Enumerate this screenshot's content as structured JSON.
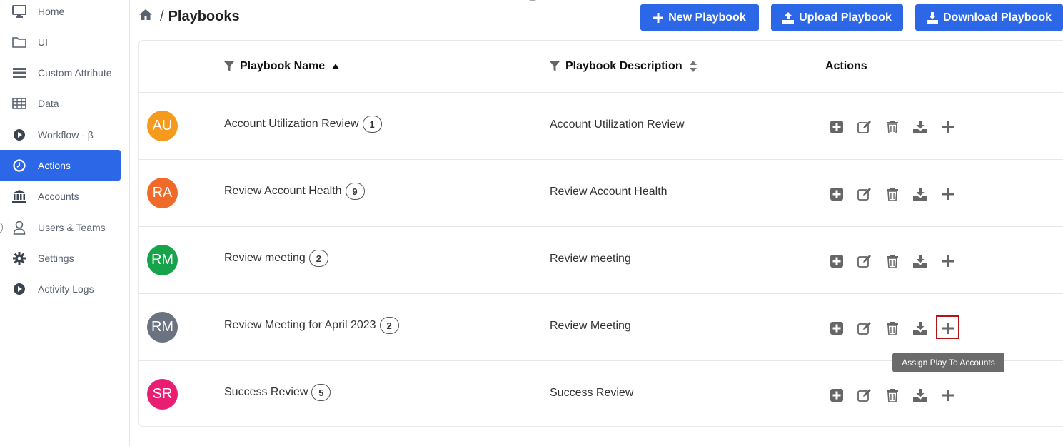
{
  "sidebar": {
    "items": [
      {
        "label": "Home",
        "icon": "monitor-icon"
      },
      {
        "label": "UI",
        "icon": "folder-icon"
      },
      {
        "label": "Custom Attribute",
        "icon": "list-icon"
      },
      {
        "label": "Data",
        "icon": "table-icon"
      },
      {
        "label": "Workflow - β",
        "icon": "play-icon"
      },
      {
        "label": "Actions",
        "icon": "clock-icon",
        "active": true
      },
      {
        "label": "Accounts",
        "icon": "bank-icon"
      },
      {
        "label": "Users & Teams",
        "icon": "user-icon"
      },
      {
        "label": "Settings",
        "icon": "gear-icon"
      },
      {
        "label": "Activity Logs",
        "icon": "play-icon"
      }
    ]
  },
  "header": {
    "breadcrumb_sep": "/",
    "title": "Playbooks",
    "new_label": "New Playbook",
    "upload_label": "Upload Playbook",
    "download_label": "Download Playbook"
  },
  "table": {
    "col_name": "Playbook Name",
    "col_desc": "Playbook Description",
    "col_actions": "Actions",
    "rows": [
      {
        "initials": "AU",
        "color": "#f49a1d",
        "name": "Account Utilization Review",
        "count": "1",
        "desc": "Account Utilization Review"
      },
      {
        "initials": "RA",
        "color": "#f06a2a",
        "name": "Review Account Health",
        "count": "9",
        "desc": "Review Account Health"
      },
      {
        "initials": "RM",
        "color": "#16a34a",
        "name": "Review meeting",
        "count": "2",
        "desc": "Review meeting"
      },
      {
        "initials": "RM",
        "color": "#6b7280",
        "name": "Review Meeting for April 2023",
        "count": "2",
        "desc": "Review Meeting"
      },
      {
        "initials": "SR",
        "color": "#e91e73",
        "name": "Success Review",
        "count": "5",
        "desc": "Success Review"
      }
    ]
  },
  "tooltip": "Assign Play To Accounts",
  "colors": {
    "accent": "#2c67e8",
    "highlight": "#b31616"
  }
}
